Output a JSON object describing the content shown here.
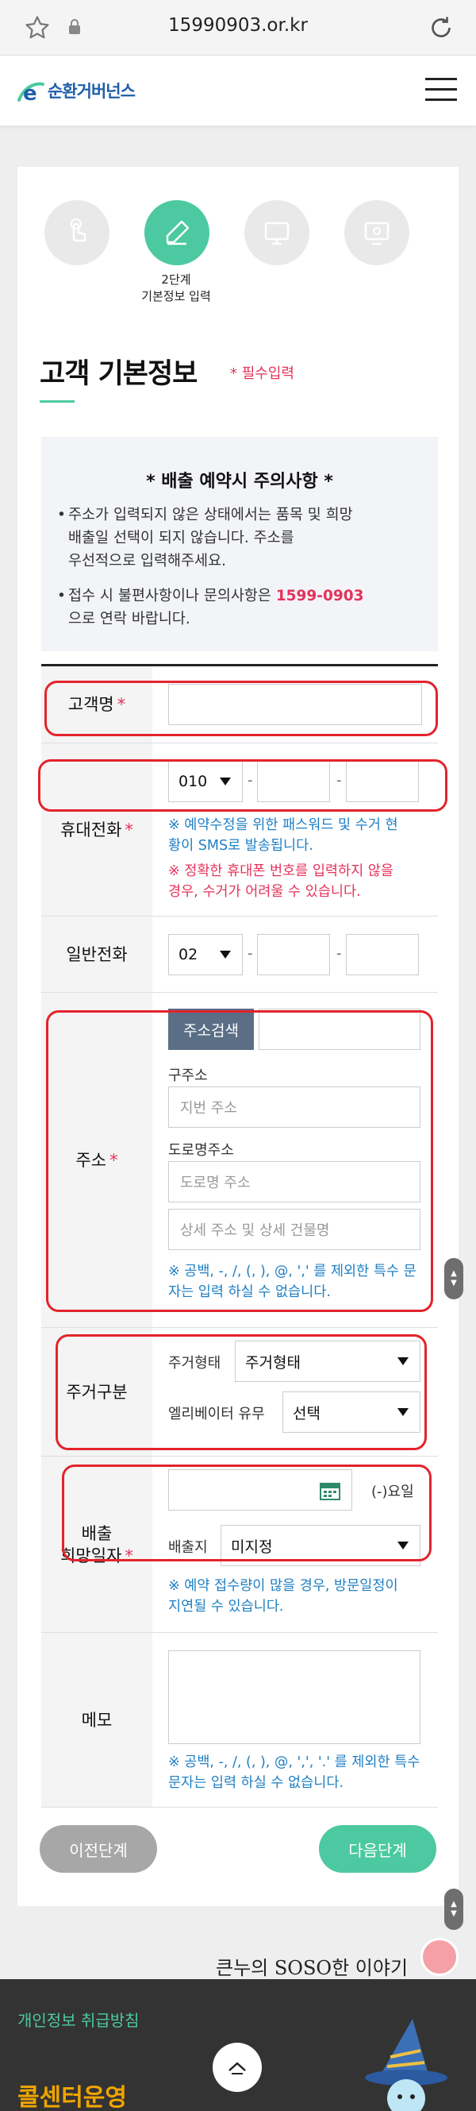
{
  "browser": {
    "url": "15990903.or.kr"
  },
  "header": {
    "logo_text": "순환거버넌스",
    "logo_letter": "e"
  },
  "steps": {
    "active_label_line1": "2단계",
    "active_label_line2": "기본정보 입력"
  },
  "page": {
    "title": "고객 기본정보",
    "required_note": "* 필수입력"
  },
  "notice": {
    "title": "*  배출 예약시 주의사항  *",
    "item1_line1": "주소가 입력되지 않은 상태에서는 품목 및 희망",
    "item1_line2": "배출일 선택이 되지 않습니다. 주소를",
    "item1_line3": "우선적으로 입력해주세요.",
    "item2_prefix": "접수 시 불편사항이나 문의사항은 ",
    "item2_phone": "1599-0903",
    "item2_suffix": "으로 연락 바랍니다."
  },
  "form": {
    "name": {
      "label": "고객명",
      "required_mark": "*"
    },
    "mobile": {
      "label": "휴대전화",
      "required_mark": "*",
      "prefix": "010",
      "hint1_line1": "※ 예약수정을 위한 패스워드 및 수거 현",
      "hint1_line2": "황이 SMS로 발송됩니다.",
      "hint2_line1": "※ 정확한 휴대폰 번호를 입력하지 않을",
      "hint2_line2": "경우, 수거가 어려울 수 있습니다."
    },
    "phone": {
      "label": "일반전화",
      "prefix": "02"
    },
    "address": {
      "label": "주소",
      "required_mark": "*",
      "search_button": "주소검색",
      "old_label": "구주소",
      "old_placeholder": "지번 주소",
      "road_label": "도로명주소",
      "road_placeholder": "도로명 주소",
      "detail_placeholder": "상세 주소 및 상세 건물명",
      "hint_line1": "※ 공백, -, /, (, ), @, ',' 를 제외한 특수 문",
      "hint_line2": "자는 입력 하실 수 없습니다."
    },
    "housing": {
      "label": "주거구분",
      "type_label": "주거형태",
      "type_value": "주거형태",
      "elevator_label": "엘리베이터 유무",
      "elevator_value": "선택"
    },
    "date": {
      "label_line1": "배출",
      "label_line2": "희망일자",
      "required_mark": "*",
      "weekday": "(-)요일",
      "place_label": "배출지",
      "place_value": "미지정",
      "hint_line1": "※ 예약 접수량이 많을 경우, 방문일정이",
      "hint_line2": "지연될 수 있습니다."
    },
    "memo": {
      "label": "메모",
      "hint_line1": "※ 공백, -, /, (, ), @, ',', '.' 를 제외한 특수",
      "hint_line2": "문자는 입력 하실 수 없습니다."
    }
  },
  "buttons": {
    "prev": "이전단계",
    "next": "다음단계"
  },
  "below": {
    "soso_title": "큰누의 SOSO한 이야기"
  },
  "footer": {
    "privacy_link": "개인정보 취급방침",
    "center_title": "콜센터운영"
  },
  "colors": {
    "accent": "#4cc9a0",
    "required": "#e5325b",
    "hint": "#1e7fc4",
    "annotation": "#e3232b"
  }
}
